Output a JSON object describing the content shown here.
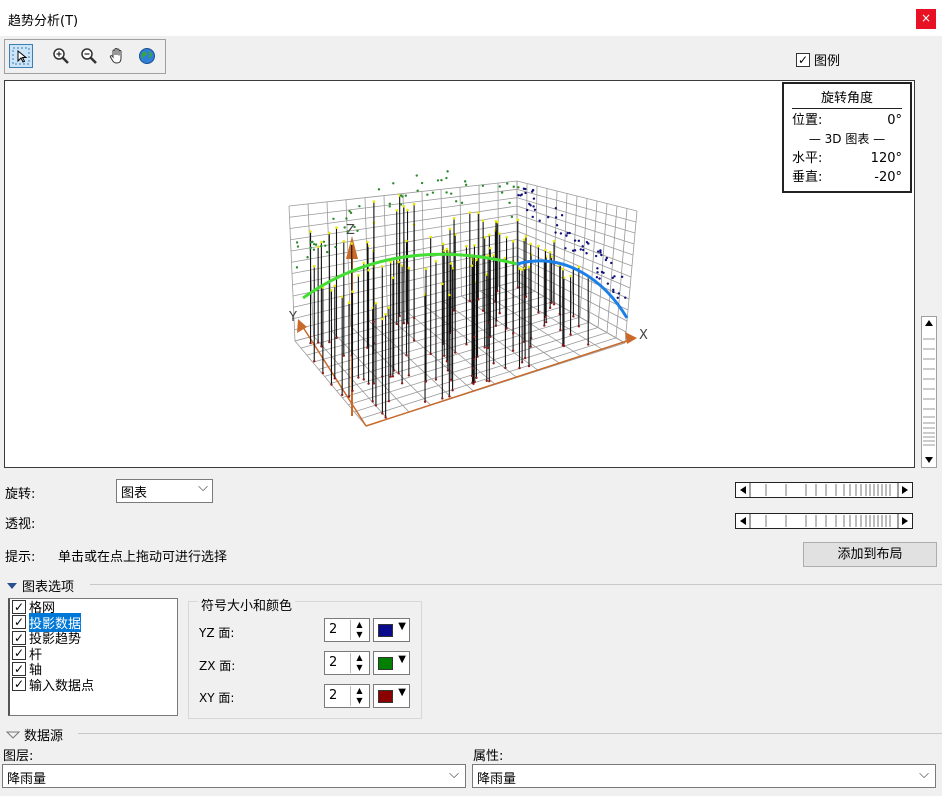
{
  "window": {
    "title": "趋势分析(T)",
    "close_glyph": "×"
  },
  "toolbar": {
    "tools": [
      "select-tool",
      "zoom-in-tool",
      "zoom-out-tool",
      "pan-tool",
      "full-extent-tool"
    ]
  },
  "legend_checkbox": {
    "label": "图例",
    "checked": true
  },
  "rotation_box": {
    "title": "旋转角度",
    "position_label": "位置:",
    "position_value": "0°",
    "section_label": "— 3D 图表 —",
    "horizontal_label": "水平:",
    "horizontal_value": "120°",
    "vertical_label": "垂直:",
    "vertical_value": "-20°"
  },
  "plot": {
    "axis_x": "X",
    "axis_y": "Y",
    "axis_z": "Z",
    "colors": {
      "grid": "#9a9a9a",
      "axes": "#c96a2b",
      "trend_yz": "#44dd33",
      "trend_xz": "#1a7fe8",
      "yz_points": "#2d8a2d",
      "xz_points": "#10107a",
      "sticks": "#111111",
      "data_points_top": "#e8e800",
      "xy_points": "#8b1a1a"
    }
  },
  "controls": {
    "rotate_label": "旋转:",
    "rotate_value": "图表",
    "perspective_label": "透视:",
    "hint_label": "提示:",
    "hint_text": "单击或在点上拖动可进行选择",
    "add_to_layout": "添加到布局"
  },
  "graph_options": {
    "section_title": "图表选项",
    "items": [
      {
        "label": "格网",
        "checked": true,
        "selected": false
      },
      {
        "label": "投影数据",
        "checked": true,
        "selected": true
      },
      {
        "label": "投影趋势",
        "checked": true,
        "selected": false
      },
      {
        "label": "杆",
        "checked": true,
        "selected": false
      },
      {
        "label": "轴",
        "checked": true,
        "selected": false
      },
      {
        "label": "输入数据点",
        "checked": true,
        "selected": false
      }
    ],
    "symbol_group_title": "符号大小和颜色",
    "planes": [
      {
        "label": "YZ 面:",
        "size": "2",
        "color": "#0a0a8c"
      },
      {
        "label": "ZX 面:",
        "size": "2",
        "color": "#008000"
      },
      {
        "label": "XY 面:",
        "size": "2",
        "color": "#8b0000"
      }
    ]
  },
  "data_source": {
    "section_title": "数据源",
    "layer_label": "图层:",
    "layer_value": "降雨量",
    "attribute_label": "属性:",
    "attribute_value": "降雨量"
  }
}
